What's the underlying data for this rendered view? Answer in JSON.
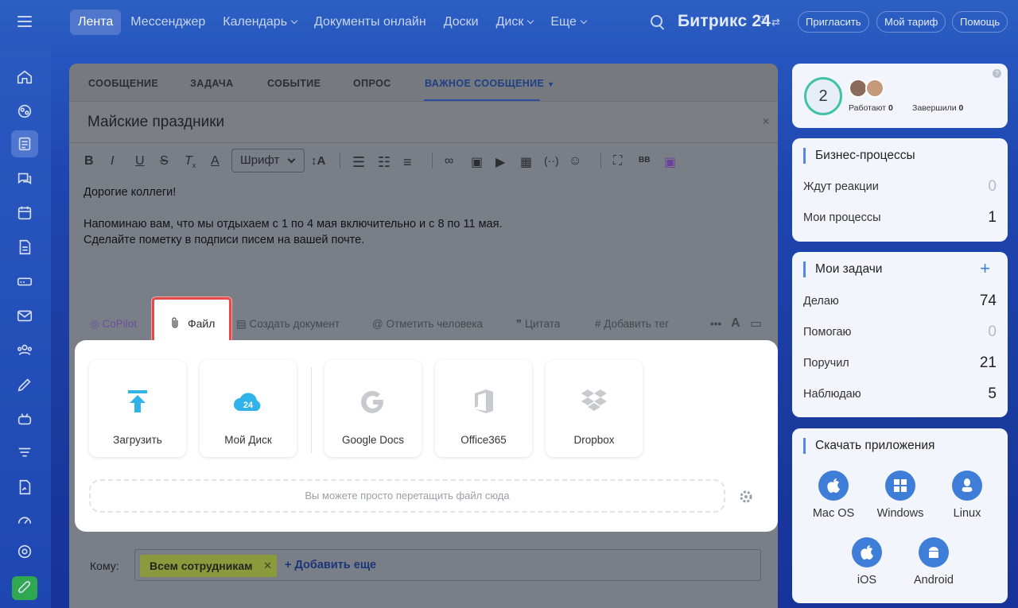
{
  "topbar": {
    "nav": [
      {
        "label": "Лента",
        "active": true,
        "dropdown": false
      },
      {
        "label": "Мессенджер",
        "active": false,
        "dropdown": false
      },
      {
        "label": "Календарь",
        "active": false,
        "dropdown": true
      },
      {
        "label": "Документы онлайн",
        "active": false,
        "dropdown": false
      },
      {
        "label": "Доски",
        "active": false,
        "dropdown": false
      },
      {
        "label": "Диск",
        "active": false,
        "dropdown": true
      },
      {
        "label": "Еще",
        "active": false,
        "dropdown": true
      }
    ],
    "brand": "Битрикс 24",
    "invite_label": "Пригласить",
    "tariff_label": "Мой тариф",
    "help_label": "Помощь"
  },
  "composer": {
    "tabs": [
      "СООБЩЕНИЕ",
      "ЗАДАЧА",
      "СОБЫТИЕ",
      "ОПРОС",
      "ВАЖНОЕ СООБЩЕНИЕ"
    ],
    "active_tab": "ВАЖНОЕ СООБЩЕНИЕ",
    "title": "Майские праздники",
    "font_select": "Шрифт",
    "body": [
      "Дорогие коллеги!",
      "",
      "Напоминаю вам, что мы отдыхаем с 1 по 4 мая включительно и с 8 по 11 мая.",
      "Сделайте пометку в подписи писем на вашей почте."
    ],
    "tools": {
      "copilot": "CoPilot",
      "file": "Файл",
      "create_doc": "Создать документ",
      "mention": "Отметить человека",
      "quote": "Цитата",
      "tag": "Добавить тег"
    },
    "to_label": "Кому:",
    "recipient_chip": "Всем сотрудникам",
    "add_more": "+ Добавить еще"
  },
  "file_panel": {
    "sources": [
      "Загрузить",
      "Мой Диск",
      "Google Docs",
      "Office365",
      "Dropbox"
    ],
    "drop_hint": "Вы можете просто перетащить файл сюда"
  },
  "right": {
    "stats": {
      "count": "2",
      "working_label": "Работают",
      "working": "0",
      "done_label": "Завершили",
      "done": "0"
    },
    "bp": {
      "title": "Бизнес-процессы",
      "rows": [
        {
          "label": "Ждут реакции",
          "value": "0"
        },
        {
          "label": "Мои процессы",
          "value": "1"
        }
      ]
    },
    "tasks": {
      "title": "Мои задачи",
      "rows": [
        {
          "label": "Делаю",
          "value": "74"
        },
        {
          "label": "Помогаю",
          "value": "0"
        },
        {
          "label": "Поручил",
          "value": "21"
        },
        {
          "label": "Наблюдаю",
          "value": "5"
        }
      ]
    },
    "apps": {
      "title": "Скачать приложения",
      "items": [
        "Mac OS",
        "Windows",
        "Linux",
        "iOS",
        "Android"
      ]
    }
  },
  "colors": {
    "accent": "#2a4ea0",
    "highlight": "#e34a4a",
    "brand_blue": "#2858bf"
  }
}
